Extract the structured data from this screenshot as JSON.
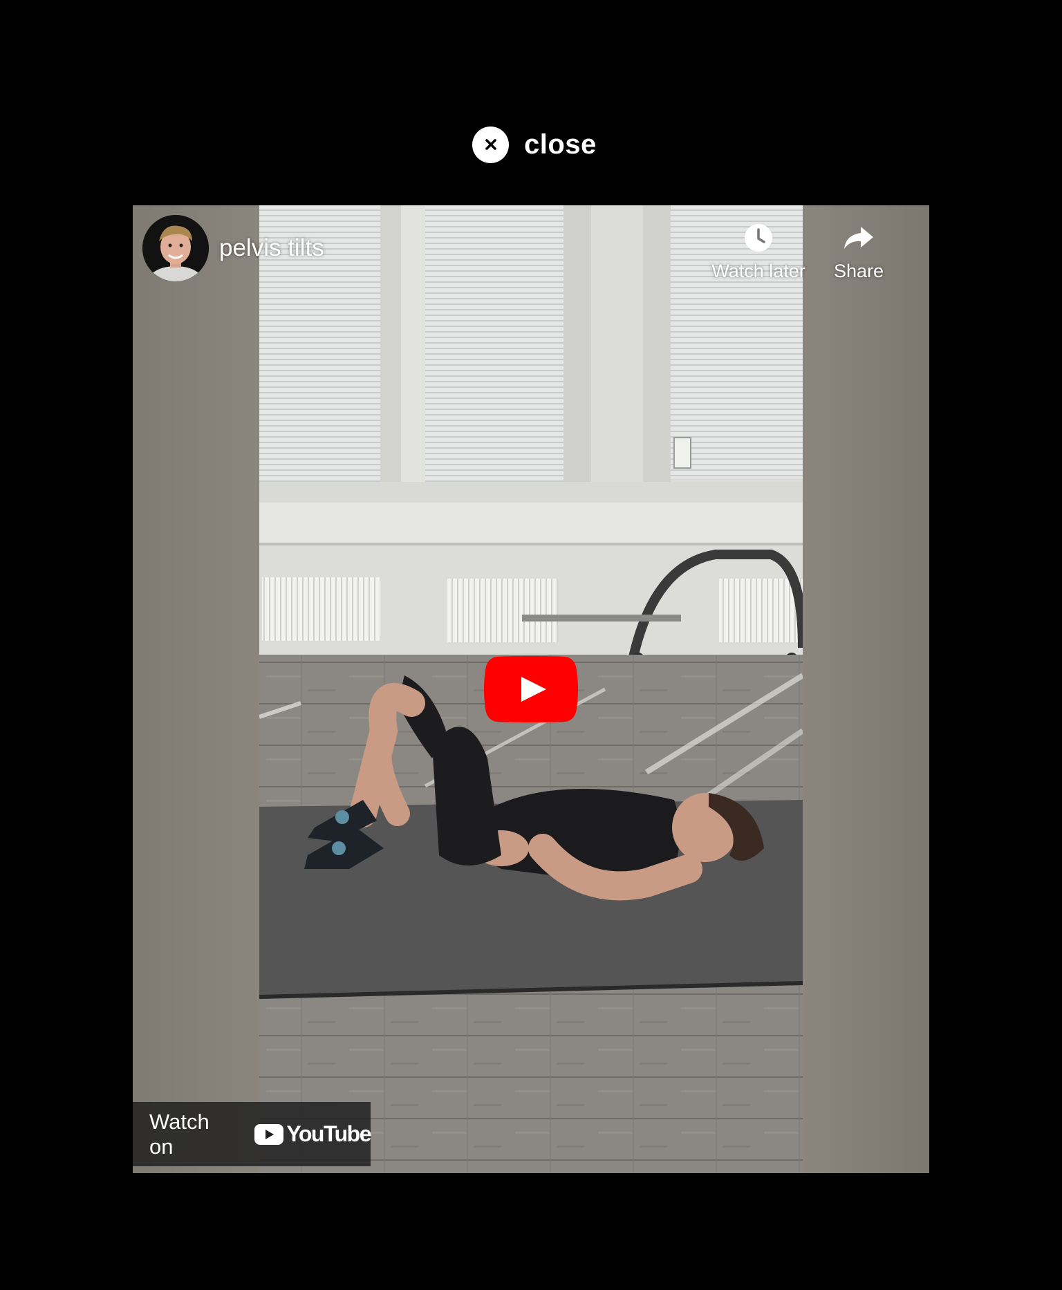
{
  "modal": {
    "close_label": "close"
  },
  "video": {
    "title": "pelvis tilts",
    "actions": {
      "watch_later_label": "Watch later",
      "share_label": "Share"
    },
    "watch_on_label": "Watch on",
    "youtube_wordmark": "YouTube",
    "colors": {
      "play_button": "#ff0000",
      "overlay_bar": "#212121"
    },
    "icons": [
      "close-icon",
      "clock-icon",
      "share-arrow-icon",
      "play-icon",
      "youtube-logo-icon"
    ]
  }
}
